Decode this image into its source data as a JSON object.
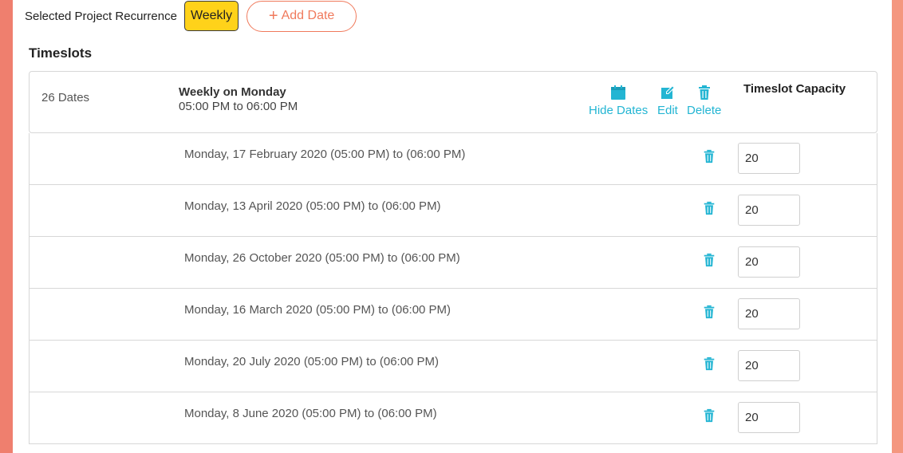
{
  "recurrence": {
    "label": "Selected Project Recurrence",
    "value": "Weekly",
    "add_date_label": "Add Date"
  },
  "timeslots": {
    "title": "Timeslots",
    "summary": {
      "count": "26 Dates",
      "schedule": "Weekly on Monday",
      "time_range": "05:00 PM to 06:00 PM"
    },
    "actions": {
      "hide_dates": "Hide Dates",
      "edit": "Edit",
      "delete": "Delete"
    },
    "capacity_header": "Timeslot Capacity",
    "dates": [
      {
        "label": "Monday, 17 February 2020 (05:00 PM) to (06:00 PM)",
        "capacity": "20"
      },
      {
        "label": "Monday, 13 April 2020 (05:00 PM) to (06:00 PM)",
        "capacity": "20"
      },
      {
        "label": "Monday, 26 October 2020 (05:00 PM) to (06:00 PM)",
        "capacity": "20"
      },
      {
        "label": "Monday, 16 March 2020 (05:00 PM) to (06:00 PM)",
        "capacity": "20"
      },
      {
        "label": "Monday, 20 July 2020 (05:00 PM) to (06:00 PM)",
        "capacity": "20"
      },
      {
        "label": "Monday, 8 June 2020 (05:00 PM) to (06:00 PM)",
        "capacity": "20"
      }
    ]
  },
  "colors": {
    "accent_orange": "#f07a5c",
    "accent_cyan": "#23b5d3",
    "badge_yellow": "#ffd21a"
  },
  "icons": {
    "calendar": "calendar-icon",
    "edit": "edit-icon",
    "trash": "trash-icon",
    "plus": "plus-icon"
  }
}
